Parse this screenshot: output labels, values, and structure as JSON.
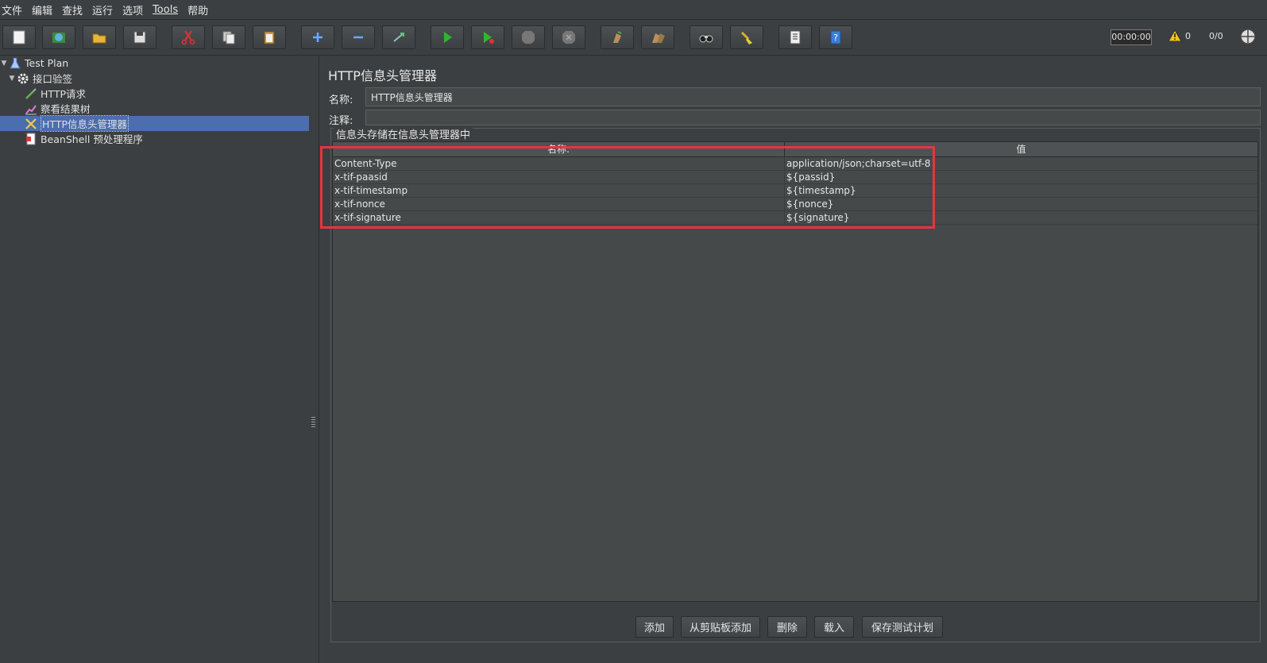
{
  "menu": [
    "文件",
    "编辑",
    "查找",
    "运行",
    "选项",
    "Tools",
    "帮助"
  ],
  "toolbar": {
    "buttons": [
      "new-icon",
      "templates-icon",
      "open-icon",
      "save-icon",
      "cut-icon",
      "copy-icon",
      "paste-icon",
      "expand-icon",
      "collapse-icon",
      "toggle-icon",
      "start-icon",
      "start-no-pause-icon",
      "stop-icon",
      "shutdown-icon",
      "clear-icon",
      "clear-all-icon",
      "search-icon",
      "reset-search-icon",
      "function-helper-icon",
      "help-icon"
    ],
    "timer": "00:00:00",
    "warning_count": "0",
    "thread_ratio": "0/0"
  },
  "tree": {
    "items": [
      {
        "label": "Test Plan",
        "icon": "flask-icon"
      },
      {
        "label": "接口验签",
        "icon": "gear-icon"
      },
      {
        "label": "HTTP请求",
        "icon": "pipette-icon"
      },
      {
        "label": "察看结果树",
        "icon": "chart-icon"
      },
      {
        "label": "HTTP信息头管理器",
        "icon": "tools-icon"
      },
      {
        "label": "BeanShell 预处理程序",
        "icon": "document-icon"
      }
    ]
  },
  "panel": {
    "title": "HTTP信息头管理器",
    "name_label": "名称:",
    "name_value": "HTTP信息头管理器",
    "comment_label": "注释:",
    "comment_value": "",
    "group_title": "信息头存储在信息头管理器中",
    "columns": [
      "名称:",
      "值"
    ],
    "rows": [
      [
        "Content-Type",
        "application/json;charset=utf-8"
      ],
      [
        "x-tif-paasid",
        "${passid}"
      ],
      [
        "x-tif-timestamp",
        "${timestamp}"
      ],
      [
        "x-tif-nonce",
        "${nonce}"
      ],
      [
        "x-tif-signature",
        "${signature}"
      ]
    ],
    "buttons": [
      "添加",
      "从剪贴板添加",
      "删除",
      "载入",
      "保存测试计划"
    ]
  },
  "colors": {
    "highlight": "#e8343c",
    "selection": "#4b6eaf",
    "background": "#3c3f41"
  }
}
